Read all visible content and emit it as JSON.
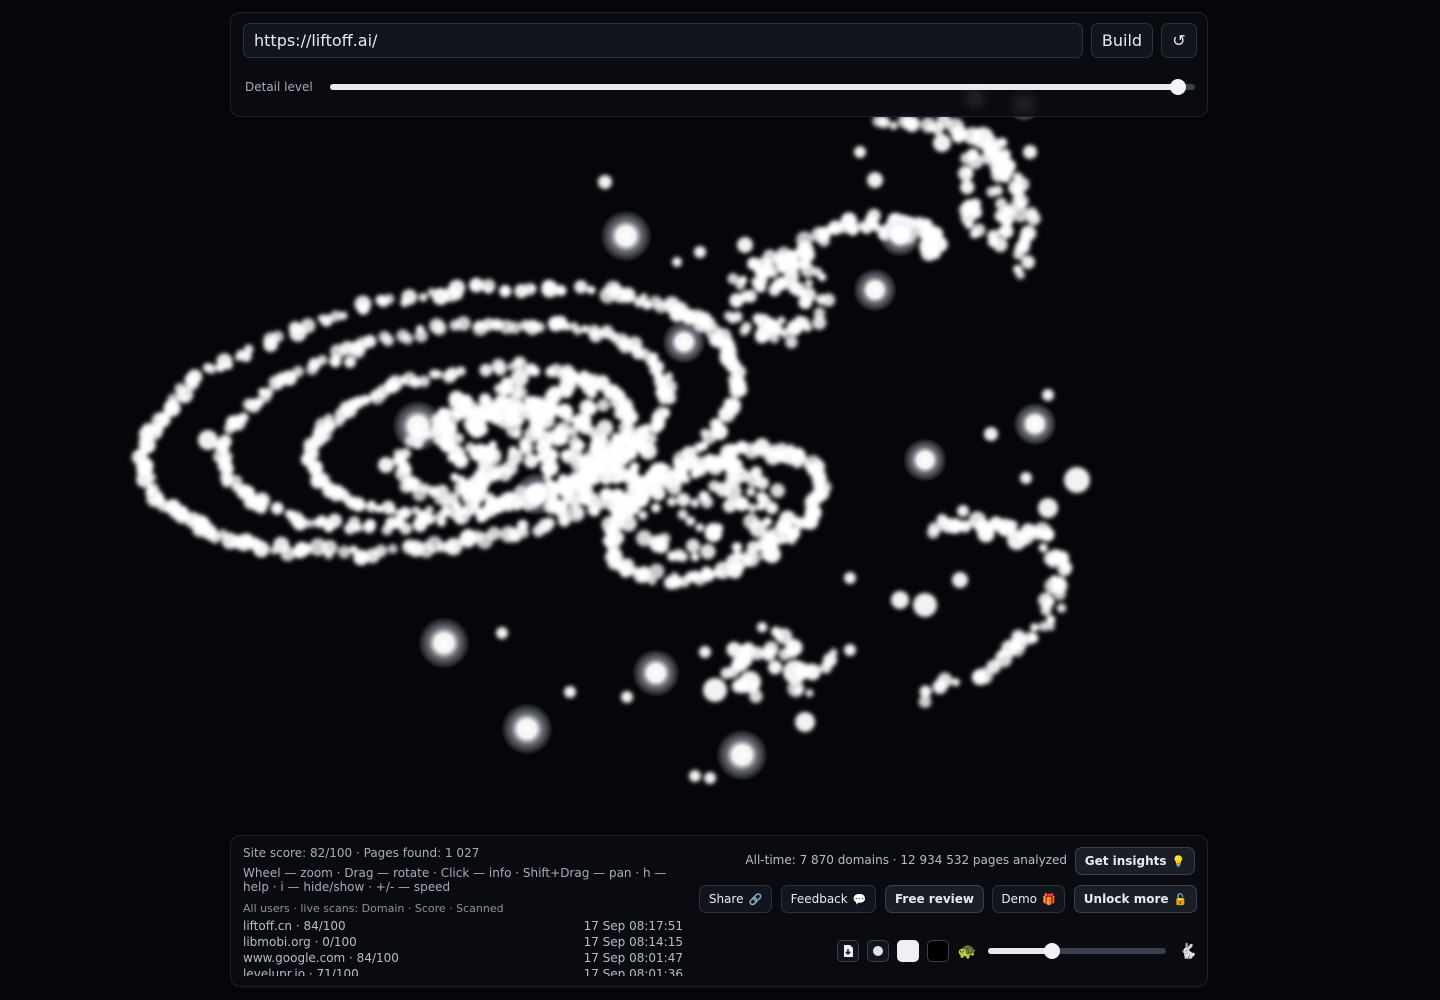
{
  "toolbar": {
    "url_value": "https://liftoff.ai/",
    "build_label": "Build",
    "reload_symbol": "↺",
    "detail_label": "Detail level",
    "detail_level": 0.98
  },
  "status": {
    "site_score": "Site score: 82/100 · Pages found: 1 027",
    "help": "Wheel — zoom · Drag — rotate · Click — info · Shift+Drag — pan · h — help · i — hide/show · +/- — speed",
    "scans_header": "All users · live scans: Domain · Score · Scanned",
    "scans": [
      {
        "domain": "liftoff.cn · 84/100",
        "time": "17 Sep 08:17:51"
      },
      {
        "domain": "libmobi.org · 0/100",
        "time": "17 Sep 08:14:15"
      },
      {
        "domain": "www.google.com · 84/100",
        "time": "17 Sep 08:01:47"
      },
      {
        "domain": "levelupr.io · 71/100",
        "time": "17 Sep 08:01:36"
      }
    ],
    "alltime": "All-time: 7 870 domains · 12 934 532 pages analyzed"
  },
  "actions": {
    "get_insights": "Get insights",
    "get_insights_emoji": "💡",
    "share": "Share",
    "share_emoji": "🔗",
    "feedback": "Feedback",
    "feedback_emoji": "💬",
    "free_review": "Free review",
    "demo": "Demo",
    "demo_emoji": "🎁",
    "unlock_more": "Unlock more",
    "unlock_emoji": "🔓"
  },
  "controls": {
    "turtle_emoji": "🐢",
    "rabbit_emoji": "🐇",
    "speed_level": 0.36
  },
  "colors": {
    "background": "#05060a",
    "particle": "#ffffff"
  }
}
